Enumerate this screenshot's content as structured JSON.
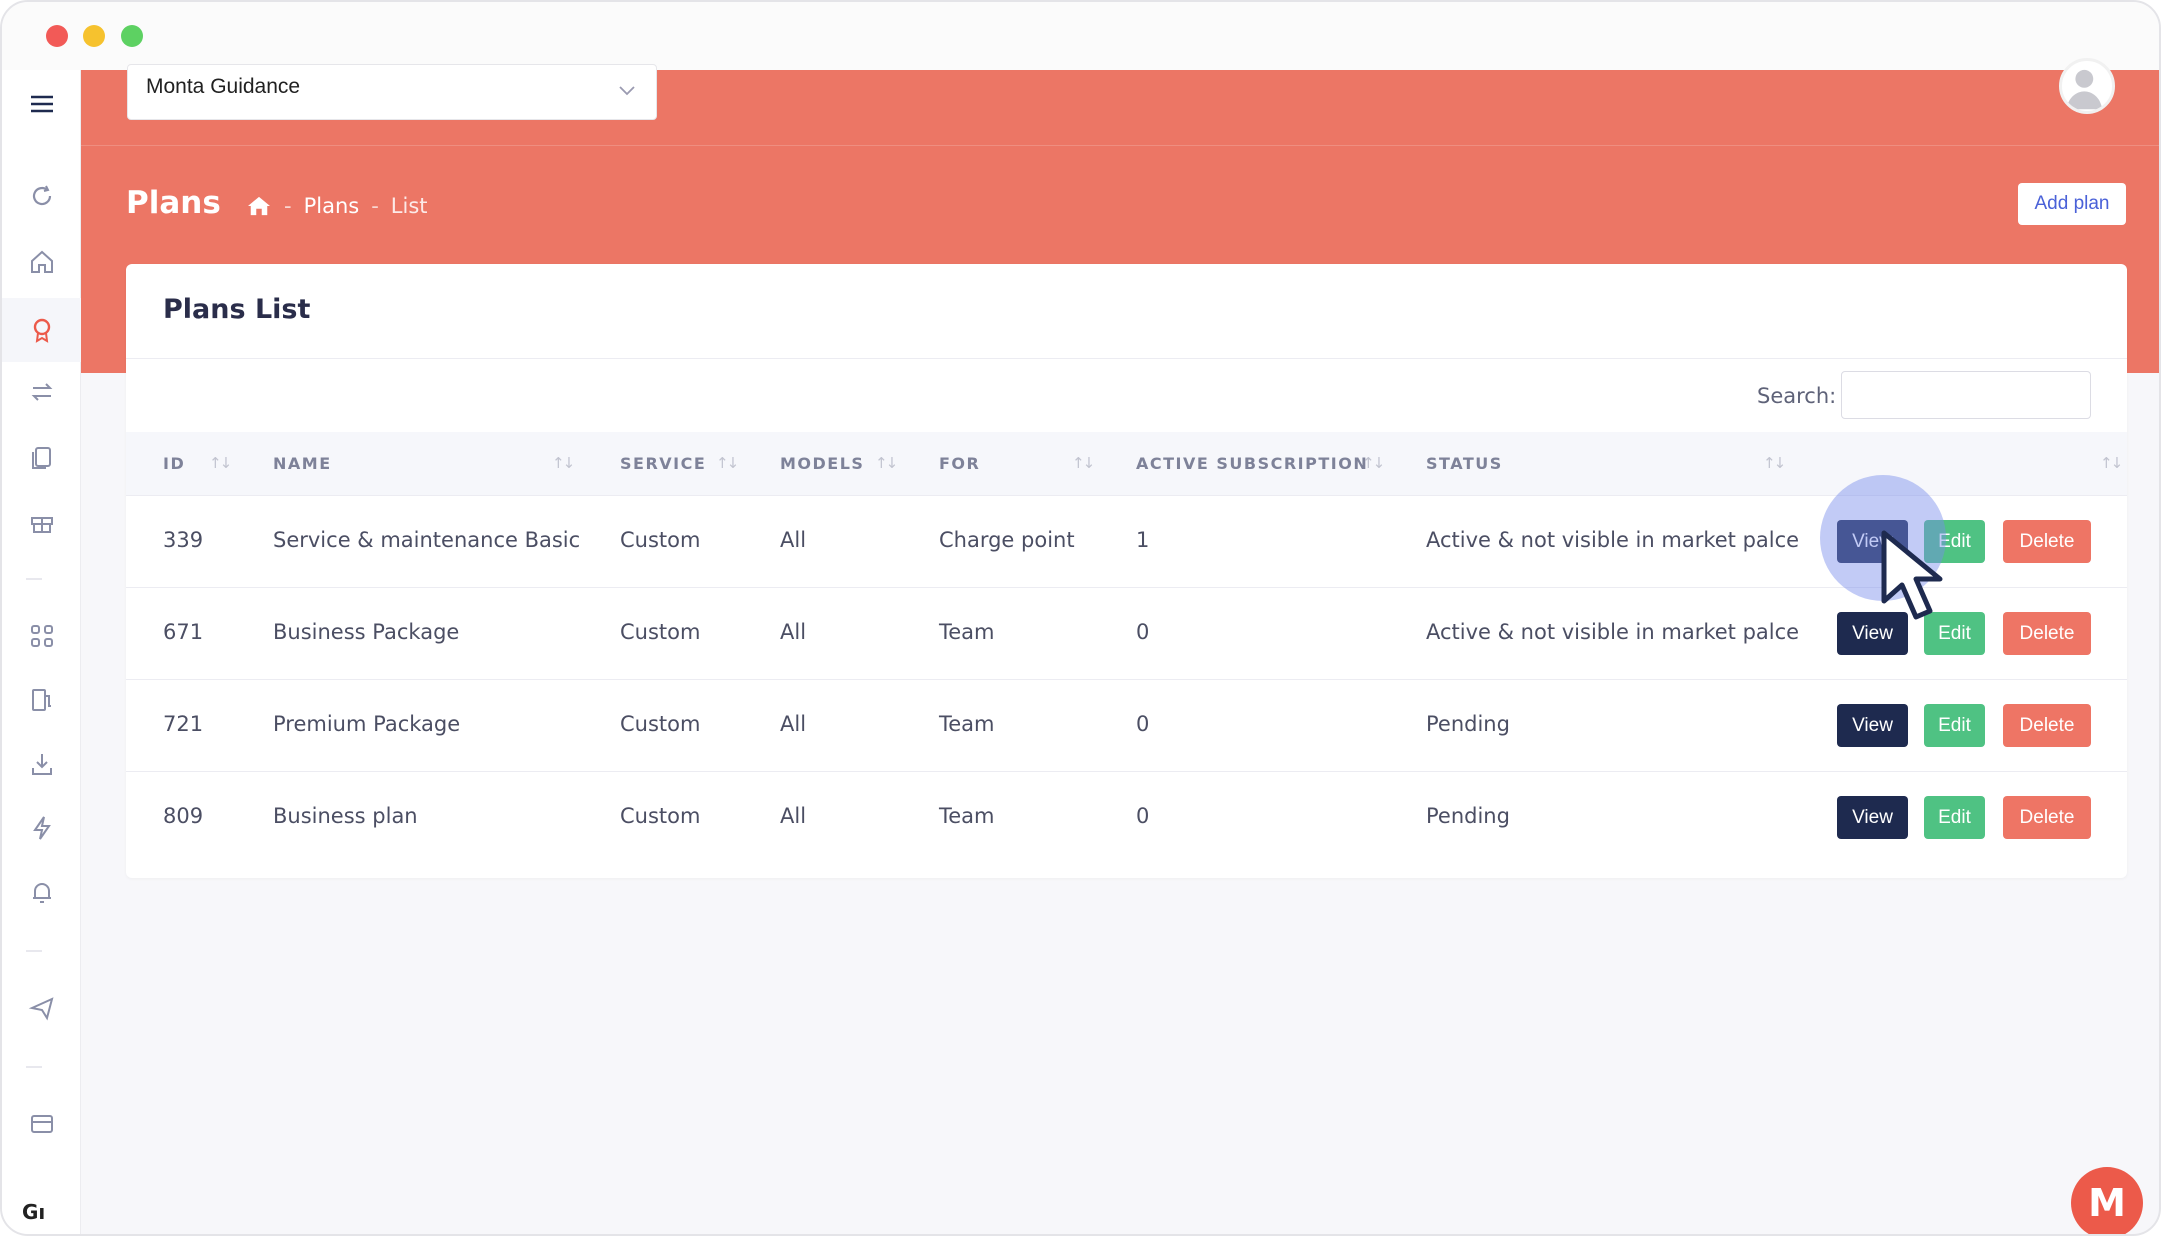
{
  "window": {
    "controls": [
      "close",
      "minimize",
      "maximize"
    ]
  },
  "header": {
    "org_select": {
      "value": "Monta Guidance"
    },
    "page_title": "Plans",
    "breadcrumb": {
      "home_icon": "home-icon",
      "items": [
        "Plans",
        "List"
      ],
      "separator": "-"
    },
    "add_button": "Add plan",
    "background_color": "#ec7665"
  },
  "sidebar": {
    "icons": [
      "menu-icon",
      "refresh-icon",
      "home-icon",
      "plans-icon",
      "transfer-icon",
      "documents-icon",
      "gift-icon",
      "grid-icon",
      "charger-icon",
      "download-icon",
      "lightning-icon",
      "alarm-icon",
      "send-icon",
      "card-icon"
    ],
    "bottom_text": "Gı"
  },
  "card": {
    "title": "Plans List",
    "search_label": "Search:",
    "search_value": "",
    "columns": [
      "ID",
      "NAME",
      "SERVICE",
      "MODELS",
      "FOR",
      "ACTIVE SUBSCRIPTION",
      "STATUS",
      ""
    ],
    "rows": [
      {
        "id": "339",
        "name": "Service & maintenance Basic",
        "service": "Custom",
        "models": "All",
        "for": "Charge point",
        "active": "1",
        "status": "Active & not visible in market palce"
      },
      {
        "id": "671",
        "name": "Business Package",
        "service": "Custom",
        "models": "All",
        "for": "Team",
        "active": "0",
        "status": "Active & not visible in market palce"
      },
      {
        "id": "721",
        "name": "Premium Package",
        "service": "Custom",
        "models": "All",
        "for": "Team",
        "active": "0",
        "status": "Pending"
      },
      {
        "id": "809",
        "name": "Business plan",
        "service": "Custom",
        "models": "All",
        "for": "Team",
        "active": "0",
        "status": "Pending"
      }
    ],
    "actions": {
      "view": "View",
      "edit": "Edit",
      "delete": "Delete"
    }
  },
  "brand_badge": "M",
  "colors": {
    "view": "#1e2a4f",
    "edit": "#4fc283",
    "delete": "#ee7565",
    "accent": "#4a61d8"
  }
}
